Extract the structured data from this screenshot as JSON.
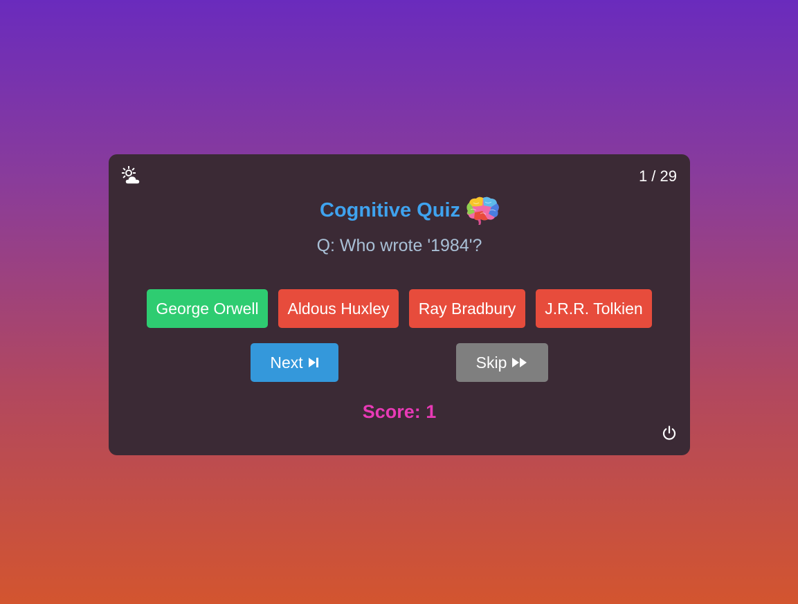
{
  "header": {
    "theme_toggle_icon": "sun-cloud-icon",
    "progress": "1 / 29"
  },
  "quiz": {
    "title": "Cognitive Quiz",
    "title_icon": "brain-icon",
    "question": "Q: Who wrote '1984'?",
    "answers": [
      {
        "label": "George Orwell",
        "state": "correct"
      },
      {
        "label": "Aldous Huxley",
        "state": "wrong"
      },
      {
        "label": "Ray Bradbury",
        "state": "wrong"
      },
      {
        "label": "J.R.R. Tolkien",
        "state": "wrong"
      }
    ]
  },
  "controls": {
    "next_label": "Next",
    "next_icon": "next-track-icon",
    "skip_label": "Skip",
    "skip_icon": "fast-forward-icon",
    "power_icon": "power-icon"
  },
  "score": {
    "text": "Score: 1"
  },
  "colors": {
    "title": "#3fa3ef",
    "correct": "#2ecc71",
    "wrong": "#e74c3c",
    "next": "#3498db",
    "skip": "#7f7f7f",
    "score": "#e83ab6",
    "card": "#3b2a35"
  }
}
